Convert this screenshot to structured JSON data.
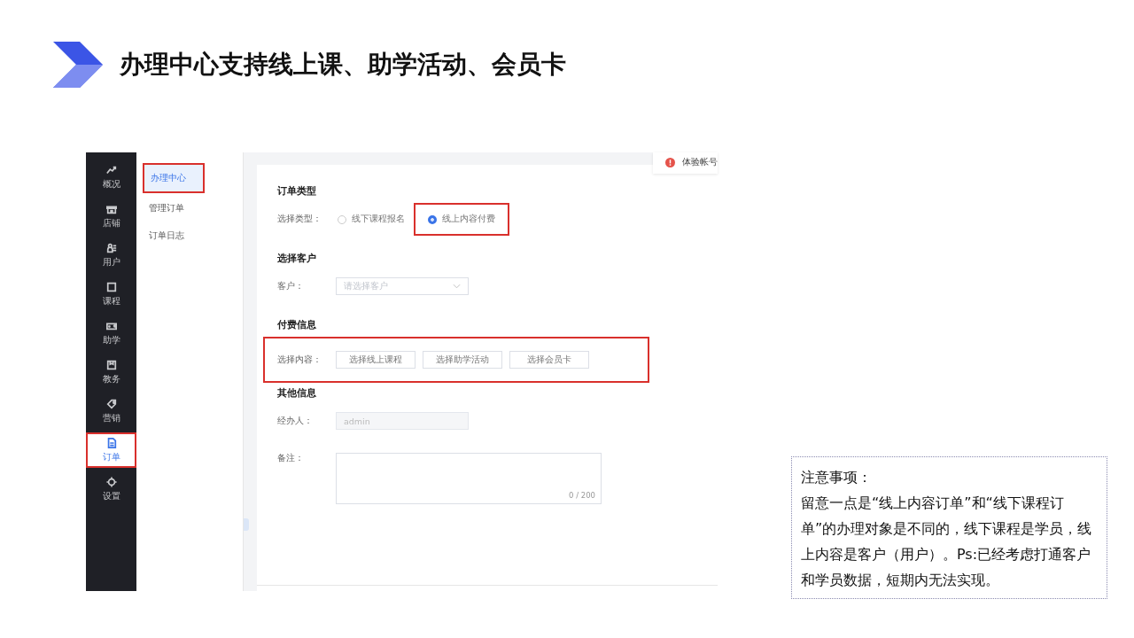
{
  "slide_title": "办理中心支持线上课、助学活动、会员卡",
  "screen": {
    "sidebar": [
      {
        "label": "概况",
        "selected": false,
        "highlighted": false
      },
      {
        "label": "店铺",
        "selected": false,
        "highlighted": false
      },
      {
        "label": "用户",
        "selected": false,
        "highlighted": false
      },
      {
        "label": "课程",
        "selected": false,
        "highlighted": false
      },
      {
        "label": "助学",
        "selected": false,
        "highlighted": false
      },
      {
        "label": "教务",
        "selected": false,
        "highlighted": false
      },
      {
        "label": "营销",
        "selected": false,
        "highlighted": false
      },
      {
        "label": "订单",
        "selected": true,
        "highlighted": true
      },
      {
        "label": "设置",
        "selected": false,
        "highlighted": false
      }
    ],
    "submenu": [
      {
        "label": "办理中心",
        "selected": true,
        "highlighted": true
      },
      {
        "label": "管理订单",
        "selected": false,
        "highlighted": false
      },
      {
        "label": "订单日志",
        "selected": false,
        "highlighted": false
      }
    ],
    "notice": "体验帐号",
    "order_type": {
      "title": "订单类型",
      "label": "选择类型：",
      "options": [
        {
          "label": "线下课程报名",
          "selected": false,
          "highlighted": false
        },
        {
          "label": "线上内容付费",
          "selected": true,
          "highlighted": true
        }
      ]
    },
    "customer": {
      "title": "选择客户",
      "label": "客户：",
      "placeholder": "请选择客户"
    },
    "payment": {
      "title": "付费信息",
      "label": "选择内容：",
      "highlighted": true,
      "buttons": [
        "选择线上课程",
        "选择助学活动",
        "选择会员卡"
      ]
    },
    "other": {
      "title": "其他信息",
      "handler_label": "经办人：",
      "handler_value": "admin",
      "remark_label": "备注：",
      "remark_count": "0 / 200"
    }
  },
  "note": {
    "heading": "注意事项：",
    "body": "留意一点是“线上内容订单”和“线下课程订单”的办理对象是不同的，线下课程是学员，线上内容是客户（用户）。Ps:已经考虑打通客户和学员数据，短期内无法实现。"
  }
}
